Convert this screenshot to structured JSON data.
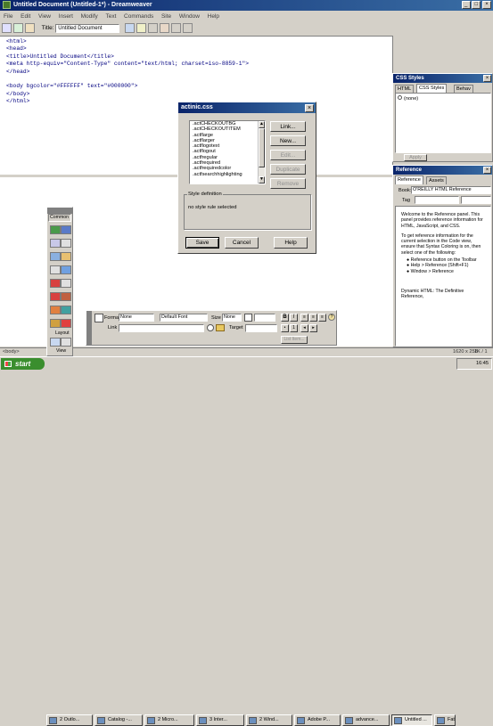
{
  "window": {
    "title": "Untitled Document (Untitled-1*) - Dreamweaver",
    "icon": "dreamweaver-icon"
  },
  "menu": [
    "File",
    "Edit",
    "View",
    "Insert",
    "Modify",
    "Text",
    "Commands",
    "Site",
    "Window",
    "Help"
  ],
  "toolbar": {
    "title_label": "Title:",
    "title_value": "Untitled Document"
  },
  "code_lines": [
    "<html>",
    "<head>",
    "<title>Untitled Document</title>",
    "<meta http-equiv=\"Content-Type\" content=\"text/html; charset=iso-8859-1\">",
    "</head>",
    "",
    "<body bgcolor=\"#FFFFFF\" text=\"#000000\">",
    "</body>",
    "</html>"
  ],
  "status": {
    "tag": "<body>",
    "size": "1620 x 258",
    "speed": "1K / 1 sec"
  },
  "css_dialog": {
    "title": "actinic.css",
    "list": [
      ".actCHECKOUTBG",
      ".actCHECKOUTITEM",
      ".actflarge",
      ".actflarger",
      ".actflogotext",
      ".actflogout",
      ".actfregular",
      ".actfrequired",
      ".actfrequiredcolor",
      ".actfsearchhighlighting"
    ],
    "buttons": [
      "Link...",
      "New...",
      "Edit...",
      "Duplicate",
      "Remove"
    ],
    "style_def_label": "Style definition",
    "style_def_text": "no style rule selected",
    "bottom_buttons": [
      "Save",
      "Cancel",
      "Help"
    ]
  },
  "css_panel": {
    "title": "CSS Styles",
    "tabs": [
      "HTML",
      "CSS Styles",
      "Behav"
    ],
    "item": "(none)",
    "apply": "Apply"
  },
  "reference": {
    "title": "Reference",
    "tabs": [
      "Reference",
      "Assets"
    ],
    "book_label": "Book:",
    "book_value": "O'REILLY HTML Reference",
    "tag_label": "Tag",
    "paragraphs": [
      "Welcome to the Reference panel. This panel provides reference information for HTML, JavaScript, and CSS.",
      "To get reference information for the current selection in the Code view, ensure that Syntax Coloring is on, then select one of the following:"
    ],
    "bullets": [
      "Reference button on the Toolbar",
      "Help > Reference (Shift+F1)",
      "Window > Reference"
    ],
    "footer": "Dynamic HTML: The Definitive Reference,"
  },
  "objects": {
    "title": "Common",
    "layout_label": "Layout",
    "view_label": "View"
  },
  "properties": {
    "format_label": "Format",
    "format_value": "None",
    "font_value": "Default Font",
    "size_label": "Size",
    "size_value": "None",
    "link_label": "Link",
    "target_label": "Target",
    "list_item_label": "List Item..."
  },
  "taskbar": {
    "start": "start",
    "tasks": [
      "2 Outlo...",
      "Catalog -...",
      "2 Micro...",
      "3 Inter...",
      "2 Wind...",
      "Adobe P...",
      "advance...",
      "Untitled ...",
      "Fatman..."
    ],
    "clock": "16:45"
  },
  "colors": {
    "title": "#0a246a",
    "title_end": "#3a6ea5",
    "desktop": "#d4d0c8",
    "start": "#3a8e2e",
    "taskbar": "#2456d8"
  }
}
